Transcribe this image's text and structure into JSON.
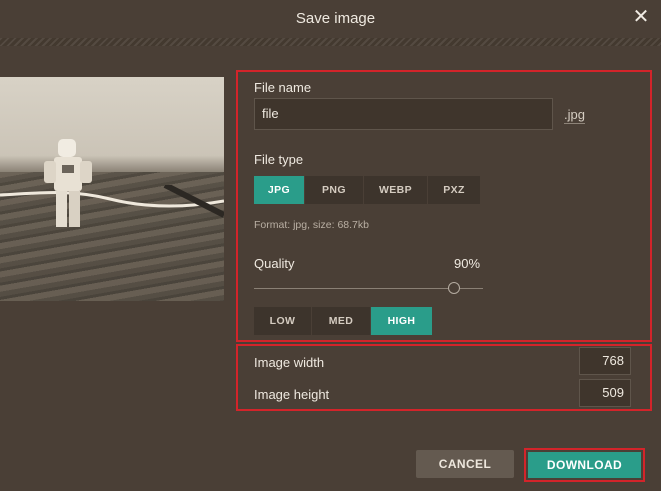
{
  "dialog": {
    "title": "Save image",
    "close_glyph": "✕"
  },
  "form": {
    "file_name_label": "File name",
    "file_name_value": "file",
    "extension": ".jpg",
    "file_type_label": "File type",
    "file_types": [
      "JPG",
      "PNG",
      "WEBP",
      "PXZ"
    ],
    "selected_file_type": "JPG",
    "format_info": "Format: jpg, size: 68.7kb",
    "quality_label": "Quality",
    "quality_value": "90%",
    "quality_levels": [
      "LOW",
      "MED",
      "HIGH"
    ],
    "selected_quality_level": "HIGH",
    "width_label": "Image width",
    "width_value": "768",
    "height_label": "Image height",
    "height_value": "509"
  },
  "actions": {
    "cancel_label": "CANCEL",
    "download_label": "DOWNLOAD"
  },
  "colors": {
    "background": "#4a3f36",
    "accent": "#2a9d8a",
    "highlight": "#d3242a"
  }
}
